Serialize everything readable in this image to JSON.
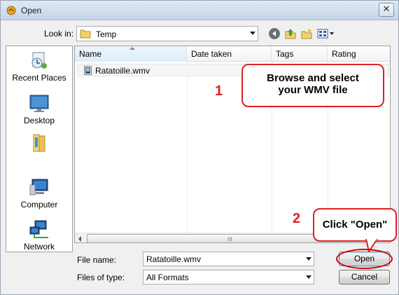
{
  "window": {
    "title": "Open",
    "close_glyph": "✕"
  },
  "toolbar": {
    "look_in_label": "Look in:",
    "look_in_value": "Temp",
    "icons": [
      "back-icon",
      "up-folder-icon",
      "new-folder-icon",
      "views-menu-icon"
    ]
  },
  "places": [
    {
      "label": "Recent Places",
      "icon": "recent-places-icon"
    },
    {
      "label": "Desktop",
      "icon": "desktop-icon"
    },
    {
      "label": "",
      "icon": "user-library-icon"
    },
    {
      "label": "Computer",
      "icon": "computer-icon"
    },
    {
      "label": "Network",
      "icon": "network-icon"
    }
  ],
  "file_list": {
    "columns": [
      "Name",
      "Date taken",
      "Tags",
      "Rating"
    ],
    "files": [
      {
        "name": "Ratatoille.wmv",
        "icon": "wmv-file-icon"
      }
    ],
    "scrollbar_grip": "III"
  },
  "footer": {
    "file_name_label": "File name:",
    "file_name_value": "Ratatoille.wmv",
    "file_type_label": "Files of type:",
    "file_type_value": "All Formats",
    "open_button": "Open",
    "cancel_button": "Cancel"
  },
  "annotations": {
    "step1_number": "1",
    "step1_text_line1": "Browse and select",
    "step1_text_line2": "your WMV file",
    "step2_number": "2",
    "step2_text": "Click \"Open\"",
    "accent_color": "#e02020"
  }
}
